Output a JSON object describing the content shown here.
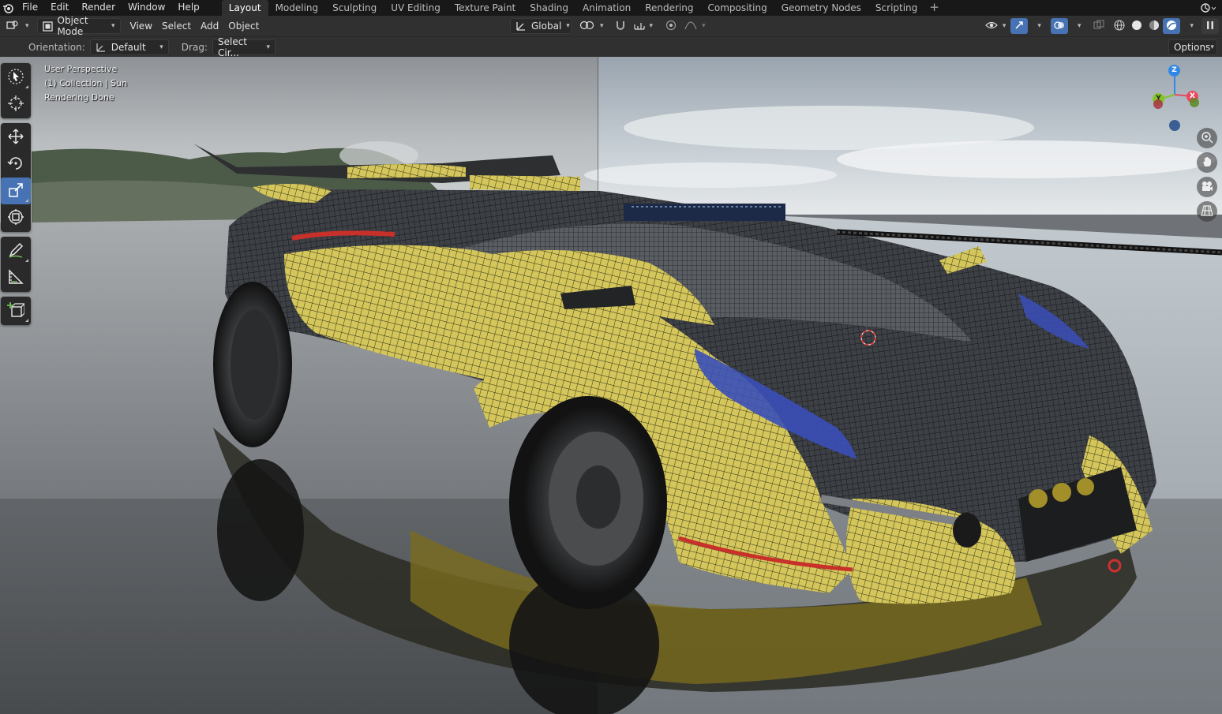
{
  "menu": {
    "items": [
      "File",
      "Edit",
      "Render",
      "Window",
      "Help"
    ]
  },
  "workspaces": {
    "tabs": [
      "Layout",
      "Modeling",
      "Sculpting",
      "UV Editing",
      "Texture Paint",
      "Shading",
      "Animation",
      "Rendering",
      "Compositing",
      "Geometry Nodes",
      "Scripting"
    ],
    "active": "Layout"
  },
  "header": {
    "mode": "Object Mode",
    "view": "View",
    "select": "Select",
    "add": "Add",
    "object": "Object",
    "transform_orientation": "Global"
  },
  "tool_settings": {
    "orientation_label": "Orientation:",
    "orientation_value": "Default",
    "drag_label": "Drag:",
    "drag_value": "Select Cir...",
    "options_label": "Options"
  },
  "viewport": {
    "perspective": "User Perspective",
    "collection": "(1) Collection | Sun",
    "status": "Rendering Done"
  },
  "gizmo": {
    "z_label": "Z",
    "y_label": "Y",
    "x_label": "X",
    "colors": {
      "x": "#e84a5f",
      "y": "#84c22a",
      "z": "#2f88e6"
    }
  },
  "toolbar": {
    "tools": [
      "select-box",
      "cursor",
      "move",
      "rotate",
      "scale",
      "transform",
      "annotate",
      "measure",
      "add-cube"
    ],
    "active": "scale"
  },
  "colors": {
    "accent": "#4772b3"
  }
}
